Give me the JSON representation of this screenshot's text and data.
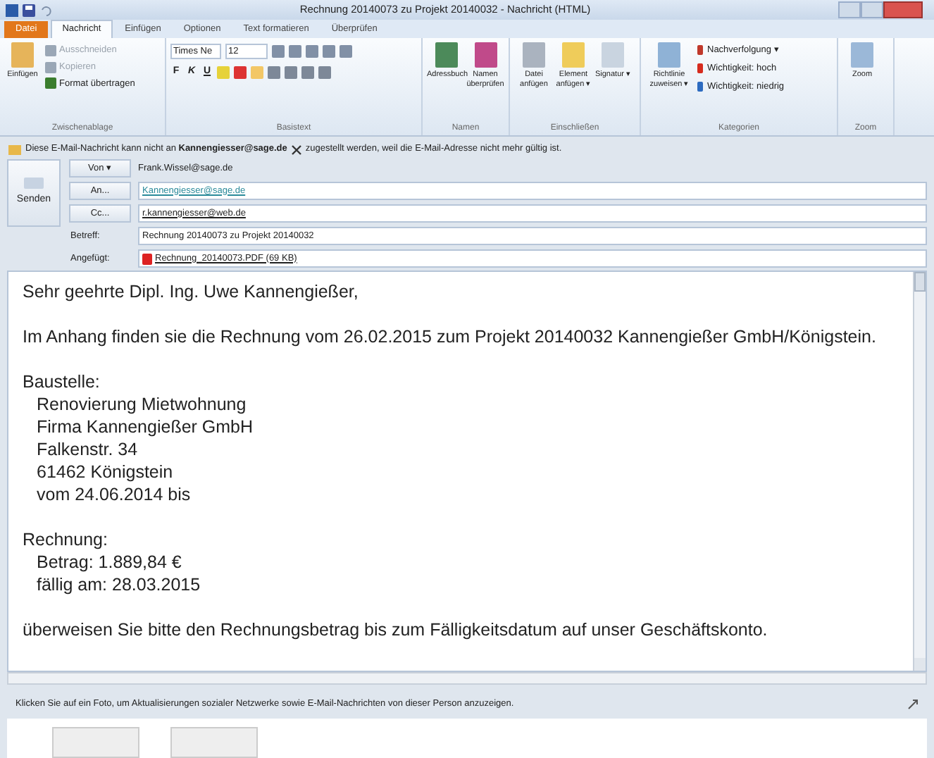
{
  "window": {
    "title": "Rechnung 20140073 zu Projekt 20140032 - Nachricht (HTML)"
  },
  "tabs": [
    {
      "label": "Datei",
      "kind": "file",
      "selected": false
    },
    {
      "label": "Nachricht",
      "kind": "tab",
      "selected": true
    },
    {
      "label": "Einfügen",
      "kind": "tab",
      "selected": false
    },
    {
      "label": "Optionen",
      "kind": "tab",
      "selected": false
    },
    {
      "label": "Text formatieren",
      "kind": "tab",
      "selected": false
    },
    {
      "label": "Überprüfen",
      "kind": "tab",
      "selected": false
    }
  ],
  "ribbon": {
    "clipboard": {
      "label": "Zwischenablage",
      "paste": "Einfügen",
      "small": [
        {
          "label": "Ausschneiden",
          "disabled": true
        },
        {
          "label": "Kopieren",
          "disabled": true
        },
        {
          "label": "Format übertragen",
          "disabled": false
        }
      ]
    },
    "basic_text": {
      "label": "Basistext",
      "font": "Times Ne",
      "size": "12",
      "styles": [
        "F",
        "K",
        "U"
      ]
    },
    "names": {
      "label": "Namen",
      "buttons": [
        "Adressbuch",
        "Namen überprüfen"
      ]
    },
    "include": {
      "label": "Einschließen",
      "buttons": [
        "Datei anfügen",
        "Element anfügen ▾",
        "Signatur ▾"
      ]
    },
    "categories": {
      "label": "Kategorien",
      "big": "Richtlinie zuweisen ▾",
      "small": [
        "Nachverfolgung ▾",
        "Wichtigkeit: hoch",
        "Wichtigkeit: niedrig"
      ]
    },
    "zoom": {
      "label": "Zoom",
      "button": "Zoom"
    }
  },
  "notice": {
    "before": "Diese E-Mail-Nachricht kann nicht an",
    "address": "Kannengiesser@sage.de",
    "after": "zugestellt werden, weil die E-Mail-Adresse nicht mehr gültig ist."
  },
  "header": {
    "send": "Senden",
    "from_button": "Von ▾",
    "from": "Frank.Wissel@sage.de",
    "to_button": "An...",
    "to": "Kannengiesser@sage.de",
    "cc_button": "Cc...",
    "cc": "r.kannengiesser@web.de",
    "subject_label": "Betreff:",
    "subject": "Rechnung 20140073 zu Projekt 20140032",
    "attached_label": "Angefügt:",
    "attachment": "Rechnung_20140073.PDF (69 KB)"
  },
  "body": [
    {
      "text": "Sehr geehrte Dipl. Ing. Uwe Kannengießer,"
    },
    {
      "text": "Im Anhang finden sie die Rechnung vom 26.02.2015 zum Projekt 20140032 Kannengießer GmbH/Königstein."
    },
    {
      "text": "Baustelle:",
      "children": [
        {
          "text": "Renovierung Mietwohnung"
        },
        {
          "text": "Firma Kannengießer GmbH"
        },
        {
          "text": "Falkenstr. 34"
        },
        {
          "text": "61462 Königstein"
        },
        {
          "text": "vom 24.06.2014 bis"
        }
      ]
    },
    {
      "text": "Rechnung:",
      "children": [
        {
          "text": "Betrag: 1.889,84 €"
        },
        {
          "text": "fällig am: 28.03.2015"
        }
      ]
    },
    {
      "text": "überweisen Sie bitte den Rechnungsbetrag bis zum Fälligkeitsdatum auf unser Geschäftskonto."
    }
  ],
  "people_pane": {
    "text": "Klicken Sie auf ein Foto, um Aktualisierungen sozialer Netzwerke sowie E-Mail-Nachrichten von dieser Person anzuzeigen."
  }
}
